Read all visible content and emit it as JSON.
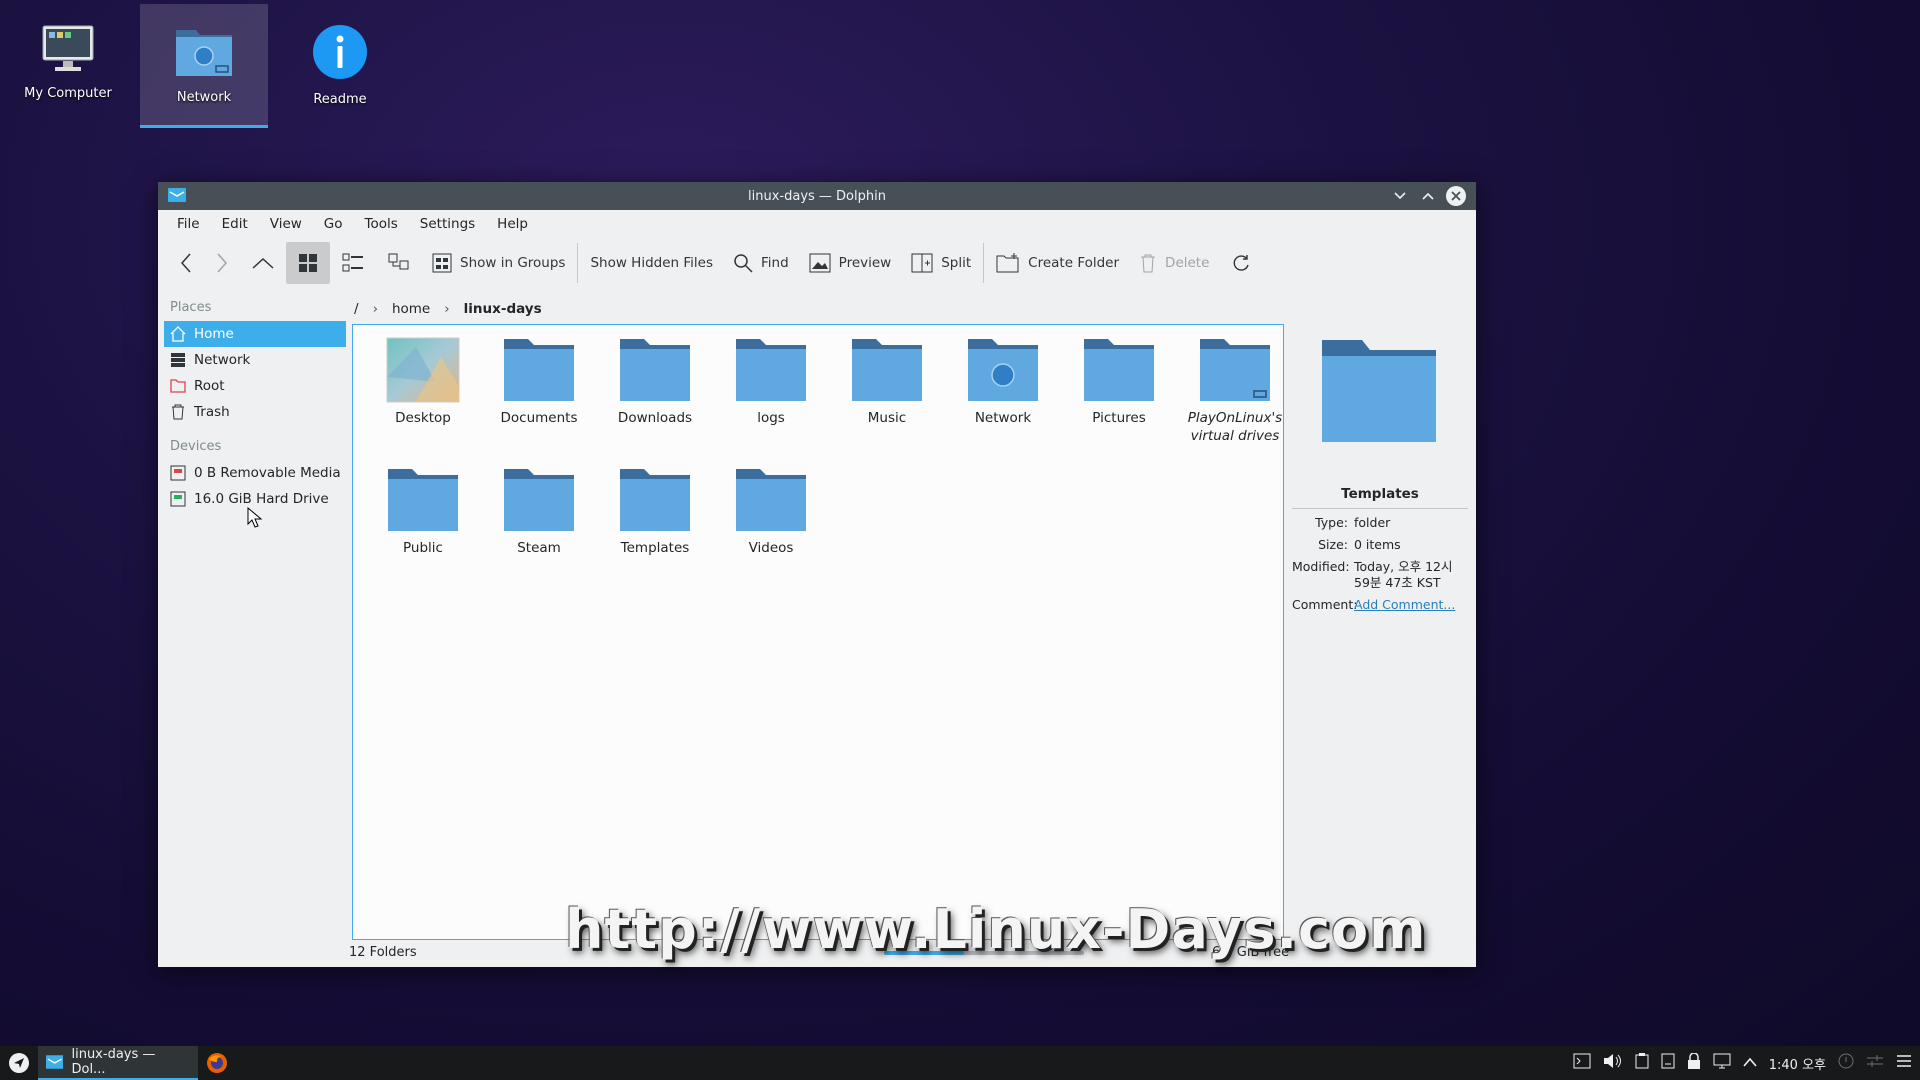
{
  "desktop": {
    "icons": [
      {
        "label": "My Computer",
        "icon": "computer-icon"
      },
      {
        "label": "Network",
        "icon": "network-folder-icon",
        "selected": true
      },
      {
        "label": "Readme",
        "icon": "info-icon"
      }
    ]
  },
  "window": {
    "title": "linux-days — Dolphin",
    "menu": [
      "File",
      "Edit",
      "View",
      "Go",
      "Tools",
      "Settings",
      "Help"
    ],
    "toolbar": {
      "show_in_groups": "Show in Groups",
      "show_hidden_files": "Show Hidden Files",
      "find": "Find",
      "preview": "Preview",
      "split": "Split",
      "create_folder": "Create Folder",
      "delete": "Delete"
    },
    "places": {
      "places_header": "Places",
      "items": [
        "Home",
        "Network",
        "Root",
        "Trash"
      ],
      "devices_header": "Devices",
      "devices": [
        "0 B Removable Media",
        "16.0 GiB Hard Drive"
      ]
    },
    "breadcrumb": {
      "root": "/",
      "home": "home",
      "current": "linux-days"
    },
    "folders": [
      {
        "name": "Desktop",
        "icon": "desktop-wallpaper-icon"
      },
      {
        "name": "Documents",
        "icon": "folder-icon"
      },
      {
        "name": "Downloads",
        "icon": "folder-icon"
      },
      {
        "name": "logs",
        "icon": "folder-icon"
      },
      {
        "name": "Music",
        "icon": "folder-icon"
      },
      {
        "name": "Network",
        "icon": "network-folder-icon"
      },
      {
        "name": "Pictures",
        "icon": "folder-icon"
      },
      {
        "name": "PlayOnLinux's virtual drives",
        "icon": "drive-folder-icon"
      },
      {
        "name": "Public",
        "icon": "folder-icon"
      },
      {
        "name": "Steam",
        "icon": "folder-icon"
      },
      {
        "name": "Templates",
        "icon": "folder-icon"
      },
      {
        "name": "Videos",
        "icon": "folder-icon"
      }
    ],
    "info": {
      "title": "Templates",
      "type_label": "Type:",
      "type": "folder",
      "size_label": "Size:",
      "size": "0 items",
      "modified_label": "Modified:",
      "modified": "Today, 오후 12시 59분 47초 KST",
      "comment_label": "Comment:",
      "comment": "Add Comment..."
    },
    "status": {
      "count": "12 Folders",
      "free": "6.3 GiB free",
      "usage_fraction": 0.4
    }
  },
  "watermark": "http://www.Linux-Days.com",
  "taskbar": {
    "task_label": "linux-days — Dol...",
    "clock": "1:40 오후"
  },
  "colors": {
    "accent": "#3daee9",
    "folder": "#5fa8e0",
    "folder_dark": "#3b6e9e",
    "titlebar": "#475057"
  }
}
